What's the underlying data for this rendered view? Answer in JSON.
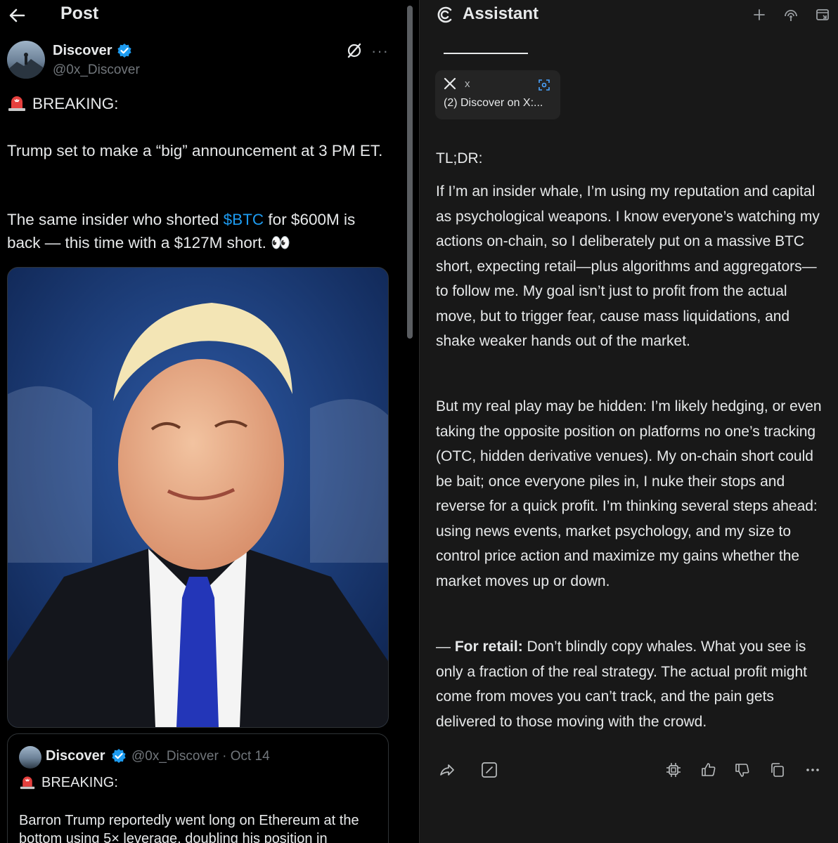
{
  "post": {
    "header_title": "Post",
    "author_name": "Discover",
    "author_handle": "@0x_Discover",
    "breaking": "BREAKING:",
    "line1": "Trump set to make a “big” announcement at 3 PM ET.",
    "line2_pre": "The same insider who shorted ",
    "line2_link": "$BTC",
    "line2_post": " for $600M is back — this time with a $127M short. 👀",
    "quote": {
      "name": "Discover",
      "handle": "@0x_Discover · Oct 14",
      "breaking": "BREAKING:",
      "text": "Barron Trump reportedly went long on Ethereum at the bottom using 5× leverage, doubling his position in"
    }
  },
  "assistant": {
    "title": "Assistant",
    "source": {
      "site": "x",
      "title": "(2) Discover on X:..."
    },
    "tldr": "TL;DR:",
    "p1": "If I’m an insider whale, I’m using my reputation and capital as psychological weapons. I know everyone’s watching my actions on-chain, so I deliberately put on a massive BTC short, expecting retail—plus algorithms and aggregators—to follow me. My goal isn’t just to profit from the actual move, but to trigger fear, cause mass liquidations, and shake weaker hands out of the market.",
    "p2": "But my real play may be hidden: I’m likely hedging, or even taking the opposite position on platforms no one’s tracking (OTC, hidden derivative venues). My on-chain short could be bait; once everyone piles in, I nuke their stops and reverse for a quick profit. I’m thinking several steps ahead: using news events, market psychology, and my size to control price action and maximize my gains whether the market moves up or down.",
    "p3_prefix": "— ",
    "p3_bold": "For retail:",
    "p3_rest": " Don’t blindly copy whales. What you see is only a fraction of the real strategy. The actual profit might come from moves you can’t track, and the pain gets delivered to those moving with the crowd."
  },
  "colors": {
    "link": "#1d9bf0",
    "verified": "#1d9bf0",
    "assistant_bg": "#181818"
  }
}
